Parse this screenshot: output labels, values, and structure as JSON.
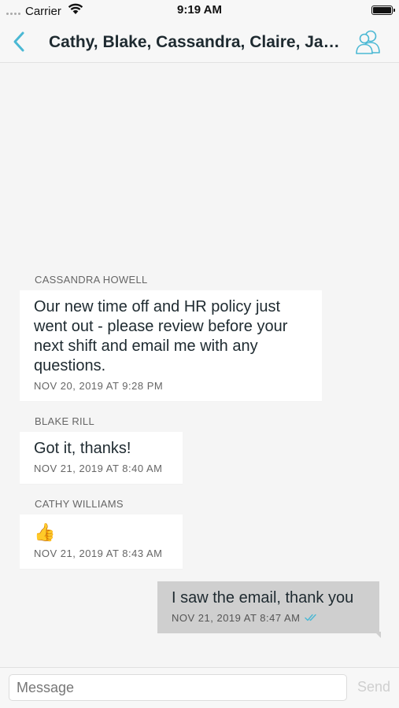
{
  "status_bar": {
    "carrier": "Carrier",
    "time": "9:19 AM",
    "battery_level": 1.0
  },
  "nav": {
    "title": "Cathy, Blake, Cassandra, Claire, Jac...",
    "back_icon": "chevron-left-icon",
    "members_icon": "people-icon",
    "accent_color": "#4ab8d4"
  },
  "messages": [
    {
      "sender": "CASSANDRA HOWELL",
      "text": "Our new time off and HR policy just went out - please review before your next shift and email me with any questions.",
      "timestamp": "NOV 20, 2019 AT 9:28 PM"
    },
    {
      "sender": "BLAKE RILL",
      "text": "Got it, thanks!",
      "timestamp": "NOV 21, 2019 AT 8:40 AM"
    },
    {
      "sender": "CATHY WILLIAMS",
      "text": "👍",
      "timestamp": "NOV 21, 2019 AT 8:43 AM"
    }
  ],
  "my_message": {
    "text": "I saw the email, thank you",
    "timestamp": "NOV 21, 2019 AT 8:47 AM",
    "read_icon": "double-check-icon"
  },
  "composer": {
    "placeholder": "Message",
    "value": "",
    "send_label": "Send"
  }
}
